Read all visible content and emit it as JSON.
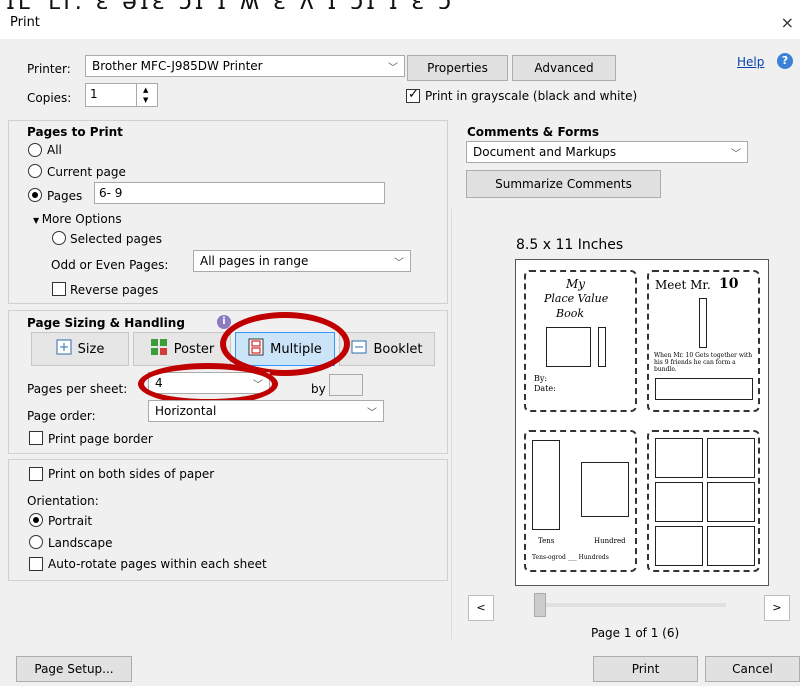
{
  "title_bar": {
    "title": "Print",
    "close": "×"
  },
  "printer": {
    "label": "Printer:",
    "value": "Brother MFC-J985DW Printer",
    "properties_label": "Properties",
    "advanced_label": "Advanced",
    "help_label": "Help",
    "copies_label": "Copies:",
    "copies_value": "1",
    "grayscale_label": "Print in grayscale (black and white)",
    "grayscale_checked": true
  },
  "pages_to_print": {
    "heading": "Pages to Print",
    "all_label": "All",
    "current_label": "Current page",
    "pages_label": "Pages",
    "pages_value": "6- 9",
    "selected_option": "pages",
    "more_options_label": "More Options",
    "selected_pages_label": "Selected pages",
    "odd_even_label": "Odd or Even Pages:",
    "odd_even_value": "All pages in range",
    "reverse_label": "Reverse pages"
  },
  "sizing": {
    "heading": "Page Sizing & Handling",
    "buttons": [
      "Size",
      "Poster",
      "Multiple",
      "Booklet"
    ],
    "active": "Multiple",
    "pages_per_sheet_label": "Pages per sheet:",
    "pages_per_sheet_value": "4",
    "by_label": "by",
    "page_order_label": "Page order:",
    "page_order_value": "Horizontal",
    "border_label": "Print page border"
  },
  "duplex": {
    "both_sides_label": "Print on both sides of paper",
    "orientation_label": "Orientation:",
    "portrait_label": "Portrait",
    "landscape_label": "Landscape",
    "selected_orientation": "portrait",
    "autorotate_label": "Auto-rotate pages within each sheet"
  },
  "comments": {
    "heading": "Comments & Forms",
    "value": "Document and Markups",
    "summarize_label": "Summarize Comments"
  },
  "preview": {
    "size_label": "8.5 x 11 Inches",
    "page_info": "Page 1 of 1 (6)",
    "prev": "<",
    "next": ">",
    "thumbs": {
      "t1_line1": "My",
      "t1_line2": "Place Value",
      "t1_line3": "Book",
      "t1_by": "By:",
      "t1_date": "Date:",
      "t2_title": "Meet Mr.",
      "t2_num": "10",
      "t2_caption": "When Mr. 10 Gets together with his 9 friends he can form a bundle.",
      "t3_left": "Tens",
      "t3_right": "Hundred",
      "t3_bottom": "Tens-ogrod ___ Hundreds"
    }
  },
  "footer": {
    "page_setup_label": "Page Setup...",
    "print_label": "Print",
    "cancel_label": "Cancel"
  }
}
